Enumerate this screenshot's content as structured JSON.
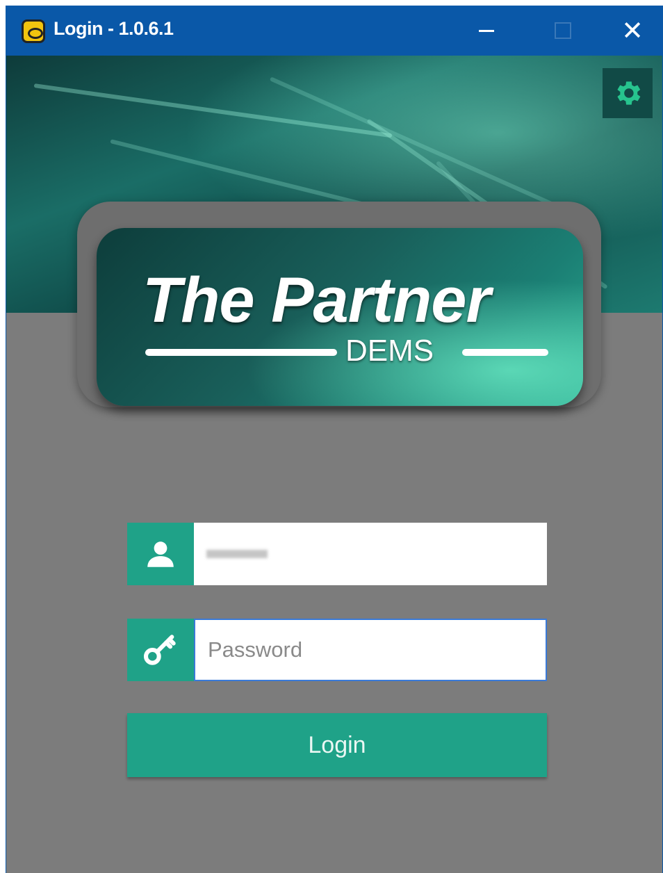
{
  "window": {
    "title": "Login - 1.0.6.1",
    "controls": {
      "minimize": "—",
      "maximize": "☐",
      "close": "✕"
    },
    "titlebar_color": "#0a58a8"
  },
  "toolbar": {
    "settings_icon": "gear-icon"
  },
  "logo": {
    "title": "The Partner",
    "subtitle": "DEMS"
  },
  "form": {
    "username_icon": "user-icon",
    "username_value": "",
    "password_icon": "key-icon",
    "password_placeholder": "Password",
    "login_label": "Login"
  },
  "colors": {
    "accent": "#1fa288",
    "background": "#7c7c7c",
    "banner": "#175f5a"
  }
}
